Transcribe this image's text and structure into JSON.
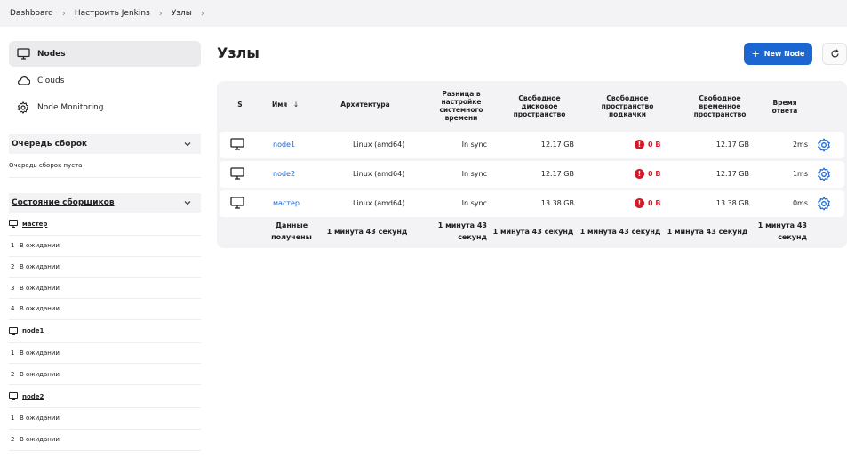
{
  "breadcrumb": [
    "Dashboard",
    "Настроить Jenkins",
    "Узлы"
  ],
  "sidebar": {
    "tasks": [
      {
        "label": "Nodes",
        "icon": "computer-icon"
      },
      {
        "label": "Clouds",
        "icon": "cloud-icon"
      },
      {
        "label": "Node Monitoring",
        "icon": "gear-icon"
      }
    ],
    "queue": {
      "title": "Очередь сборок",
      "empty_text": "Очередь сборок пуста"
    },
    "executors": {
      "title": "Состояние сборщиков",
      "nodes": [
        {
          "name": "мастер",
          "executors": [
            {
              "num": "1",
              "status": "В ожидании"
            },
            {
              "num": "2",
              "status": "В ожидании"
            },
            {
              "num": "3",
              "status": "В ожидании"
            },
            {
              "num": "4",
              "status": "В ожидании"
            }
          ]
        },
        {
          "name": "node1",
          "executors": [
            {
              "num": "1",
              "status": "В ожидании"
            },
            {
              "num": "2",
              "status": "В ожидании"
            }
          ]
        },
        {
          "name": "node2",
          "executors": [
            {
              "num": "1",
              "status": "В ожидании"
            },
            {
              "num": "2",
              "status": "В ожидании"
            }
          ]
        }
      ]
    }
  },
  "main": {
    "title": "Узлы",
    "new_node_label": "New Node",
    "table": {
      "headers": {
        "s": "S",
        "name": "Имя",
        "sort_arrow": "↓",
        "arch": "Архитектура",
        "clock": "Разница в настройке системного времени",
        "disk": "Свободное дисковое пространство",
        "swap": "Свободное пространство подкачки",
        "temp": "Свободное временное пространство",
        "response": "Время ответа"
      },
      "rows": [
        {
          "name": "node1",
          "arch": "Linux (amd64)",
          "clock": "In sync",
          "disk": "12.17 GB",
          "swap": "0 B",
          "temp": "12.17 GB",
          "response": "2ms"
        },
        {
          "name": "node2",
          "arch": "Linux (amd64)",
          "clock": "In sync",
          "disk": "12.17 GB",
          "swap": "0 B",
          "temp": "12.17 GB",
          "response": "1ms"
        },
        {
          "name": "мастер",
          "arch": "Linux (amd64)",
          "clock": "In sync",
          "disk": "13.38 GB",
          "swap": "0 B",
          "temp": "13.38 GB",
          "response": "0ms"
        }
      ],
      "footer": {
        "label": "Данные получены",
        "arch": "1 минута 43 секунд",
        "clock": "1 минута 43 секунд",
        "disk": "1 минута 43 секунд",
        "swap": "1 минута 43 секунд",
        "temp": "1 минута 43 секунд",
        "response": "1 минута 43 секунд"
      }
    }
  },
  "colors": {
    "accent": "#1b66d1",
    "danger": "#d11a2a",
    "panel_bg": "#f3f3f5"
  }
}
